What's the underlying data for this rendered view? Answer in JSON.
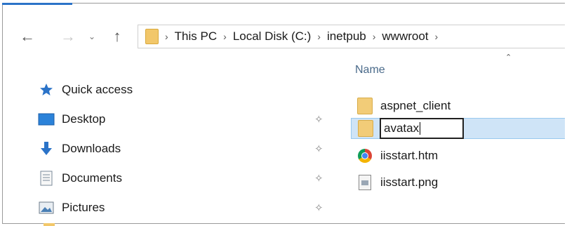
{
  "nav": {
    "back_icon": "back-arrow-icon",
    "forward_icon": "forward-arrow-icon",
    "recent_icon": "chevron-down-icon",
    "up_icon": "up-arrow-icon"
  },
  "breadcrumb": [
    "This PC",
    "Local Disk (C:)",
    "inetpub",
    "wwwroot"
  ],
  "sidebar": {
    "items": [
      {
        "label": "Quick access",
        "icon": "star-icon"
      },
      {
        "label": "Desktop",
        "icon": "desktop-icon"
      },
      {
        "label": "Downloads",
        "icon": "download-arrow-icon"
      },
      {
        "label": "Documents",
        "icon": "document-icon"
      },
      {
        "label": "Pictures",
        "icon": "pictures-icon"
      }
    ]
  },
  "file_list": {
    "column_name": "Name",
    "rows": [
      {
        "name": "aspnet_client",
        "type": "folder"
      },
      {
        "name": "avatax",
        "type": "folder",
        "renaming": true
      },
      {
        "name": "iisstart.htm",
        "type": "chrome-html"
      },
      {
        "name": "iisstart.png",
        "type": "image"
      }
    ]
  },
  "colors": {
    "accent": "#2b73c8",
    "selection": "#cfe4f7",
    "folder": "#f2cc78"
  }
}
